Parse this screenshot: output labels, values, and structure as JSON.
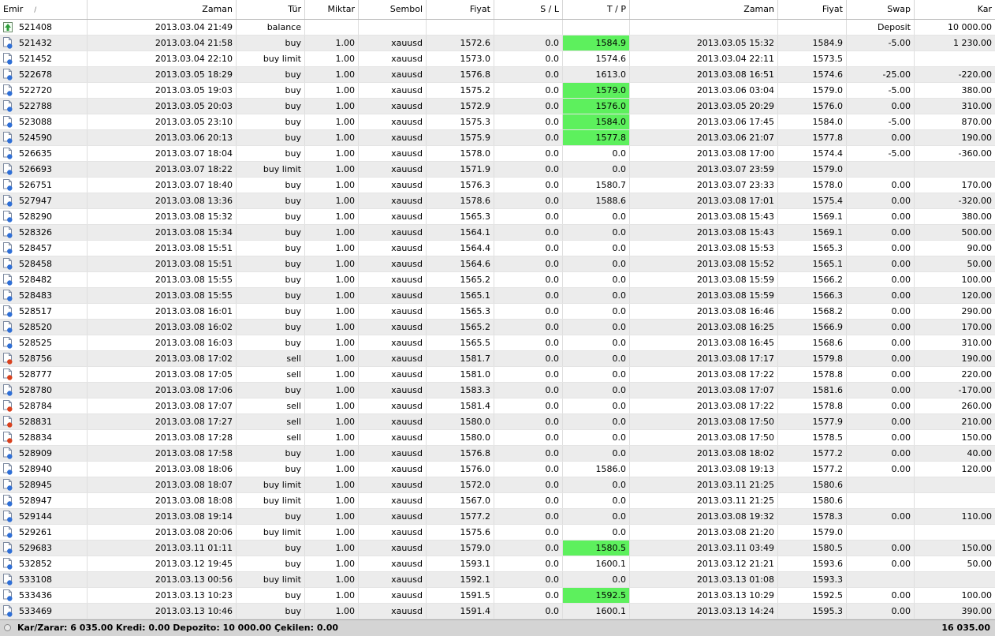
{
  "headers": {
    "emir": "Emir",
    "sort_indicator": "/",
    "zaman_open": "Zaman",
    "tur": "Tür",
    "miktar": "Miktar",
    "sembol": "Sembol",
    "fiyat_open": "Fiyat",
    "sl": "S / L",
    "tp": "T / P",
    "zaman_close": "Zaman",
    "fiyat_close": "Fiyat",
    "swap": "Swap",
    "kar": "Kar"
  },
  "colors": {
    "tp_hit": "#5df05d",
    "buy_icon": "#2f6fd6",
    "sell_icon": "#d9411e",
    "balance_icon": "#2e9e3a"
  },
  "rows": [
    {
      "emir": "521408",
      "time": "2013.03.04 21:49",
      "type": "balance",
      "icon": "balance-icon",
      "lots": "",
      "symbol": "",
      "price": "",
      "sl": "",
      "tp": "",
      "tp_hit": false,
      "close_time": "",
      "close_price": "",
      "swap": "Deposit",
      "profit": "10 000.00"
    },
    {
      "emir": "521432",
      "time": "2013.03.04 21:58",
      "type": "buy",
      "icon": "buy-order-icon",
      "lots": "1.00",
      "symbol": "xauusd",
      "price": "1572.6",
      "sl": "0.0",
      "tp": "1584.9",
      "tp_hit": true,
      "close_time": "2013.03.05 15:32",
      "close_price": "1584.9",
      "swap": "-5.00",
      "profit": "1 230.00"
    },
    {
      "emir": "521452",
      "time": "2013.03.04 22:10",
      "type": "buy limit",
      "icon": "buy-order-icon",
      "lots": "1.00",
      "symbol": "xauusd",
      "price": "1573.0",
      "sl": "0.0",
      "tp": "1574.6",
      "tp_hit": false,
      "close_time": "2013.03.04 22:11",
      "close_price": "1573.5",
      "swap": "",
      "profit": ""
    },
    {
      "emir": "522678",
      "time": "2013.03.05 18:29",
      "type": "buy",
      "icon": "buy-order-icon",
      "lots": "1.00",
      "symbol": "xauusd",
      "price": "1576.8",
      "sl": "0.0",
      "tp": "1613.0",
      "tp_hit": false,
      "close_time": "2013.03.08 16:51",
      "close_price": "1574.6",
      "swap": "-25.00",
      "profit": "-220.00"
    },
    {
      "emir": "522720",
      "time": "2013.03.05 19:03",
      "type": "buy",
      "icon": "buy-order-icon",
      "lots": "1.00",
      "symbol": "xauusd",
      "price": "1575.2",
      "sl": "0.0",
      "tp": "1579.0",
      "tp_hit": true,
      "close_time": "2013.03.06 03:04",
      "close_price": "1579.0",
      "swap": "-5.00",
      "profit": "380.00"
    },
    {
      "emir": "522788",
      "time": "2013.03.05 20:03",
      "type": "buy",
      "icon": "buy-order-icon",
      "lots": "1.00",
      "symbol": "xauusd",
      "price": "1572.9",
      "sl": "0.0",
      "tp": "1576.0",
      "tp_hit": true,
      "close_time": "2013.03.05 20:29",
      "close_price": "1576.0",
      "swap": "0.00",
      "profit": "310.00"
    },
    {
      "emir": "523088",
      "time": "2013.03.05 23:10",
      "type": "buy",
      "icon": "buy-order-icon",
      "lots": "1.00",
      "symbol": "xauusd",
      "price": "1575.3",
      "sl": "0.0",
      "tp": "1584.0",
      "tp_hit": true,
      "close_time": "2013.03.06 17:45",
      "close_price": "1584.0",
      "swap": "-5.00",
      "profit": "870.00"
    },
    {
      "emir": "524590",
      "time": "2013.03.06 20:13",
      "type": "buy",
      "icon": "buy-order-icon",
      "lots": "1.00",
      "symbol": "xauusd",
      "price": "1575.9",
      "sl": "0.0",
      "tp": "1577.8",
      "tp_hit": true,
      "close_time": "2013.03.06 21:07",
      "close_price": "1577.8",
      "swap": "0.00",
      "profit": "190.00"
    },
    {
      "emir": "526635",
      "time": "2013.03.07 18:04",
      "type": "buy",
      "icon": "buy-order-icon",
      "lots": "1.00",
      "symbol": "xauusd",
      "price": "1578.0",
      "sl": "0.0",
      "tp": "0.0",
      "tp_hit": false,
      "close_time": "2013.03.08 17:00",
      "close_price": "1574.4",
      "swap": "-5.00",
      "profit": "-360.00"
    },
    {
      "emir": "526693",
      "time": "2013.03.07 18:22",
      "type": "buy limit",
      "icon": "buy-order-icon",
      "lots": "1.00",
      "symbol": "xauusd",
      "price": "1571.9",
      "sl": "0.0",
      "tp": "0.0",
      "tp_hit": false,
      "close_time": "2013.03.07 23:59",
      "close_price": "1579.0",
      "swap": "",
      "profit": ""
    },
    {
      "emir": "526751",
      "time": "2013.03.07 18:40",
      "type": "buy",
      "icon": "buy-order-icon",
      "lots": "1.00",
      "symbol": "xauusd",
      "price": "1576.3",
      "sl": "0.0",
      "tp": "1580.7",
      "tp_hit": false,
      "close_time": "2013.03.07 23:33",
      "close_price": "1578.0",
      "swap": "0.00",
      "profit": "170.00"
    },
    {
      "emir": "527947",
      "time": "2013.03.08 13:36",
      "type": "buy",
      "icon": "buy-order-icon",
      "lots": "1.00",
      "symbol": "xauusd",
      "price": "1578.6",
      "sl": "0.0",
      "tp": "1588.6",
      "tp_hit": false,
      "close_time": "2013.03.08 17:01",
      "close_price": "1575.4",
      "swap": "0.00",
      "profit": "-320.00"
    },
    {
      "emir": "528290",
      "time": "2013.03.08 15:32",
      "type": "buy",
      "icon": "buy-order-icon",
      "lots": "1.00",
      "symbol": "xauusd",
      "price": "1565.3",
      "sl": "0.0",
      "tp": "0.0",
      "tp_hit": false,
      "close_time": "2013.03.08 15:43",
      "close_price": "1569.1",
      "swap": "0.00",
      "profit": "380.00"
    },
    {
      "emir": "528326",
      "time": "2013.03.08 15:34",
      "type": "buy",
      "icon": "buy-order-icon",
      "lots": "1.00",
      "symbol": "xauusd",
      "price": "1564.1",
      "sl": "0.0",
      "tp": "0.0",
      "tp_hit": false,
      "close_time": "2013.03.08 15:43",
      "close_price": "1569.1",
      "swap": "0.00",
      "profit": "500.00"
    },
    {
      "emir": "528457",
      "time": "2013.03.08 15:51",
      "type": "buy",
      "icon": "buy-order-icon",
      "lots": "1.00",
      "symbol": "xauusd",
      "price": "1564.4",
      "sl": "0.0",
      "tp": "0.0",
      "tp_hit": false,
      "close_time": "2013.03.08 15:53",
      "close_price": "1565.3",
      "swap": "0.00",
      "profit": "90.00"
    },
    {
      "emir": "528458",
      "time": "2013.03.08 15:51",
      "type": "buy",
      "icon": "buy-order-icon",
      "lots": "1.00",
      "symbol": "xauusd",
      "price": "1564.6",
      "sl": "0.0",
      "tp": "0.0",
      "tp_hit": false,
      "close_time": "2013.03.08 15:52",
      "close_price": "1565.1",
      "swap": "0.00",
      "profit": "50.00"
    },
    {
      "emir": "528482",
      "time": "2013.03.08 15:55",
      "type": "buy",
      "icon": "buy-order-icon",
      "lots": "1.00",
      "symbol": "xauusd",
      "price": "1565.2",
      "sl": "0.0",
      "tp": "0.0",
      "tp_hit": false,
      "close_time": "2013.03.08 15:59",
      "close_price": "1566.2",
      "swap": "0.00",
      "profit": "100.00"
    },
    {
      "emir": "528483",
      "time": "2013.03.08 15:55",
      "type": "buy",
      "icon": "buy-order-icon",
      "lots": "1.00",
      "symbol": "xauusd",
      "price": "1565.1",
      "sl": "0.0",
      "tp": "0.0",
      "tp_hit": false,
      "close_time": "2013.03.08 15:59",
      "close_price": "1566.3",
      "swap": "0.00",
      "profit": "120.00"
    },
    {
      "emir": "528517",
      "time": "2013.03.08 16:01",
      "type": "buy",
      "icon": "buy-order-icon",
      "lots": "1.00",
      "symbol": "xauusd",
      "price": "1565.3",
      "sl": "0.0",
      "tp": "0.0",
      "tp_hit": false,
      "close_time": "2013.03.08 16:46",
      "close_price": "1568.2",
      "swap": "0.00",
      "profit": "290.00"
    },
    {
      "emir": "528520",
      "time": "2013.03.08 16:02",
      "type": "buy",
      "icon": "buy-order-icon",
      "lots": "1.00",
      "symbol": "xauusd",
      "price": "1565.2",
      "sl": "0.0",
      "tp": "0.0",
      "tp_hit": false,
      "close_time": "2013.03.08 16:25",
      "close_price": "1566.9",
      "swap": "0.00",
      "profit": "170.00"
    },
    {
      "emir": "528525",
      "time": "2013.03.08 16:03",
      "type": "buy",
      "icon": "buy-order-icon",
      "lots": "1.00",
      "symbol": "xauusd",
      "price": "1565.5",
      "sl": "0.0",
      "tp": "0.0",
      "tp_hit": false,
      "close_time": "2013.03.08 16:45",
      "close_price": "1568.6",
      "swap": "0.00",
      "profit": "310.00"
    },
    {
      "emir": "528756",
      "time": "2013.03.08 17:02",
      "type": "sell",
      "icon": "sell-order-icon",
      "lots": "1.00",
      "symbol": "xauusd",
      "price": "1581.7",
      "sl": "0.0",
      "tp": "0.0",
      "tp_hit": false,
      "close_time": "2013.03.08 17:17",
      "close_price": "1579.8",
      "swap": "0.00",
      "profit": "190.00"
    },
    {
      "emir": "528777",
      "time": "2013.03.08 17:05",
      "type": "sell",
      "icon": "sell-order-icon",
      "lots": "1.00",
      "symbol": "xauusd",
      "price": "1581.0",
      "sl": "0.0",
      "tp": "0.0",
      "tp_hit": false,
      "close_time": "2013.03.08 17:22",
      "close_price": "1578.8",
      "swap": "0.00",
      "profit": "220.00"
    },
    {
      "emir": "528780",
      "time": "2013.03.08 17:06",
      "type": "buy",
      "icon": "buy-order-icon",
      "lots": "1.00",
      "symbol": "xauusd",
      "price": "1583.3",
      "sl": "0.0",
      "tp": "0.0",
      "tp_hit": false,
      "close_time": "2013.03.08 17:07",
      "close_price": "1581.6",
      "swap": "0.00",
      "profit": "-170.00"
    },
    {
      "emir": "528784",
      "time": "2013.03.08 17:07",
      "type": "sell",
      "icon": "sell-order-icon",
      "lots": "1.00",
      "symbol": "xauusd",
      "price": "1581.4",
      "sl": "0.0",
      "tp": "0.0",
      "tp_hit": false,
      "close_time": "2013.03.08 17:22",
      "close_price": "1578.8",
      "swap": "0.00",
      "profit": "260.00"
    },
    {
      "emir": "528831",
      "time": "2013.03.08 17:27",
      "type": "sell",
      "icon": "sell-order-icon",
      "lots": "1.00",
      "symbol": "xauusd",
      "price": "1580.0",
      "sl": "0.0",
      "tp": "0.0",
      "tp_hit": false,
      "close_time": "2013.03.08 17:50",
      "close_price": "1577.9",
      "swap": "0.00",
      "profit": "210.00"
    },
    {
      "emir": "528834",
      "time": "2013.03.08 17:28",
      "type": "sell",
      "icon": "sell-order-icon",
      "lots": "1.00",
      "symbol": "xauusd",
      "price": "1580.0",
      "sl": "0.0",
      "tp": "0.0",
      "tp_hit": false,
      "close_time": "2013.03.08 17:50",
      "close_price": "1578.5",
      "swap": "0.00",
      "profit": "150.00"
    },
    {
      "emir": "528909",
      "time": "2013.03.08 17:58",
      "type": "buy",
      "icon": "buy-order-icon",
      "lots": "1.00",
      "symbol": "xauusd",
      "price": "1576.8",
      "sl": "0.0",
      "tp": "0.0",
      "tp_hit": false,
      "close_time": "2013.03.08 18:02",
      "close_price": "1577.2",
      "swap": "0.00",
      "profit": "40.00"
    },
    {
      "emir": "528940",
      "time": "2013.03.08 18:06",
      "type": "buy",
      "icon": "buy-order-icon",
      "lots": "1.00",
      "symbol": "xauusd",
      "price": "1576.0",
      "sl": "0.0",
      "tp": "1586.0",
      "tp_hit": false,
      "close_time": "2013.03.08 19:13",
      "close_price": "1577.2",
      "swap": "0.00",
      "profit": "120.00"
    },
    {
      "emir": "528945",
      "time": "2013.03.08 18:07",
      "type": "buy limit",
      "icon": "buy-order-icon",
      "lots": "1.00",
      "symbol": "xauusd",
      "price": "1572.0",
      "sl": "0.0",
      "tp": "0.0",
      "tp_hit": false,
      "close_time": "2013.03.11 21:25",
      "close_price": "1580.6",
      "swap": "",
      "profit": ""
    },
    {
      "emir": "528947",
      "time": "2013.03.08 18:08",
      "type": "buy limit",
      "icon": "buy-order-icon",
      "lots": "1.00",
      "symbol": "xauusd",
      "price": "1567.0",
      "sl": "0.0",
      "tp": "0.0",
      "tp_hit": false,
      "close_time": "2013.03.11 21:25",
      "close_price": "1580.6",
      "swap": "",
      "profit": ""
    },
    {
      "emir": "529144",
      "time": "2013.03.08 19:14",
      "type": "buy",
      "icon": "buy-order-icon",
      "lots": "1.00",
      "symbol": "xauusd",
      "price": "1577.2",
      "sl": "0.0",
      "tp": "0.0",
      "tp_hit": false,
      "close_time": "2013.03.08 19:32",
      "close_price": "1578.3",
      "swap": "0.00",
      "profit": "110.00"
    },
    {
      "emir": "529261",
      "time": "2013.03.08 20:06",
      "type": "buy limit",
      "icon": "buy-order-icon",
      "lots": "1.00",
      "symbol": "xauusd",
      "price": "1575.6",
      "sl": "0.0",
      "tp": "0.0",
      "tp_hit": false,
      "close_time": "2013.03.08 21:20",
      "close_price": "1579.0",
      "swap": "",
      "profit": ""
    },
    {
      "emir": "529683",
      "time": "2013.03.11 01:11",
      "type": "buy",
      "icon": "buy-order-icon",
      "lots": "1.00",
      "symbol": "xauusd",
      "price": "1579.0",
      "sl": "0.0",
      "tp": "1580.5",
      "tp_hit": true,
      "close_time": "2013.03.11 03:49",
      "close_price": "1580.5",
      "swap": "0.00",
      "profit": "150.00"
    },
    {
      "emir": "532852",
      "time": "2013.03.12 19:45",
      "type": "buy",
      "icon": "buy-order-icon",
      "lots": "1.00",
      "symbol": "xauusd",
      "price": "1593.1",
      "sl": "0.0",
      "tp": "1600.1",
      "tp_hit": false,
      "close_time": "2013.03.12 21:21",
      "close_price": "1593.6",
      "swap": "0.00",
      "profit": "50.00"
    },
    {
      "emir": "533108",
      "time": "2013.03.13 00:56",
      "type": "buy limit",
      "icon": "buy-order-icon",
      "lots": "1.00",
      "symbol": "xauusd",
      "price": "1592.1",
      "sl": "0.0",
      "tp": "0.0",
      "tp_hit": false,
      "close_time": "2013.03.13 01:08",
      "close_price": "1593.3",
      "swap": "",
      "profit": ""
    },
    {
      "emir": "533436",
      "time": "2013.03.13 10:23",
      "type": "buy",
      "icon": "buy-order-icon",
      "lots": "1.00",
      "symbol": "xauusd",
      "price": "1591.5",
      "sl": "0.0",
      "tp": "1592.5",
      "tp_hit": true,
      "close_time": "2013.03.13 10:29",
      "close_price": "1592.5",
      "swap": "0.00",
      "profit": "100.00"
    },
    {
      "emir": "533469",
      "time": "2013.03.13 10:46",
      "type": "buy",
      "icon": "buy-order-icon",
      "lots": "1.00",
      "symbol": "xauusd",
      "price": "1591.4",
      "sl": "0.0",
      "tp": "1600.1",
      "tp_hit": false,
      "close_time": "2013.03.13 14:24",
      "close_price": "1595.3",
      "swap": "0.00",
      "profit": "390.00"
    }
  ],
  "footer": {
    "summary": "Kar/Zarar: 6 035.00  Kredi: 0.00  Depozito: 10 000.00  Çekilen: 0.00",
    "total": "16 035.00"
  }
}
